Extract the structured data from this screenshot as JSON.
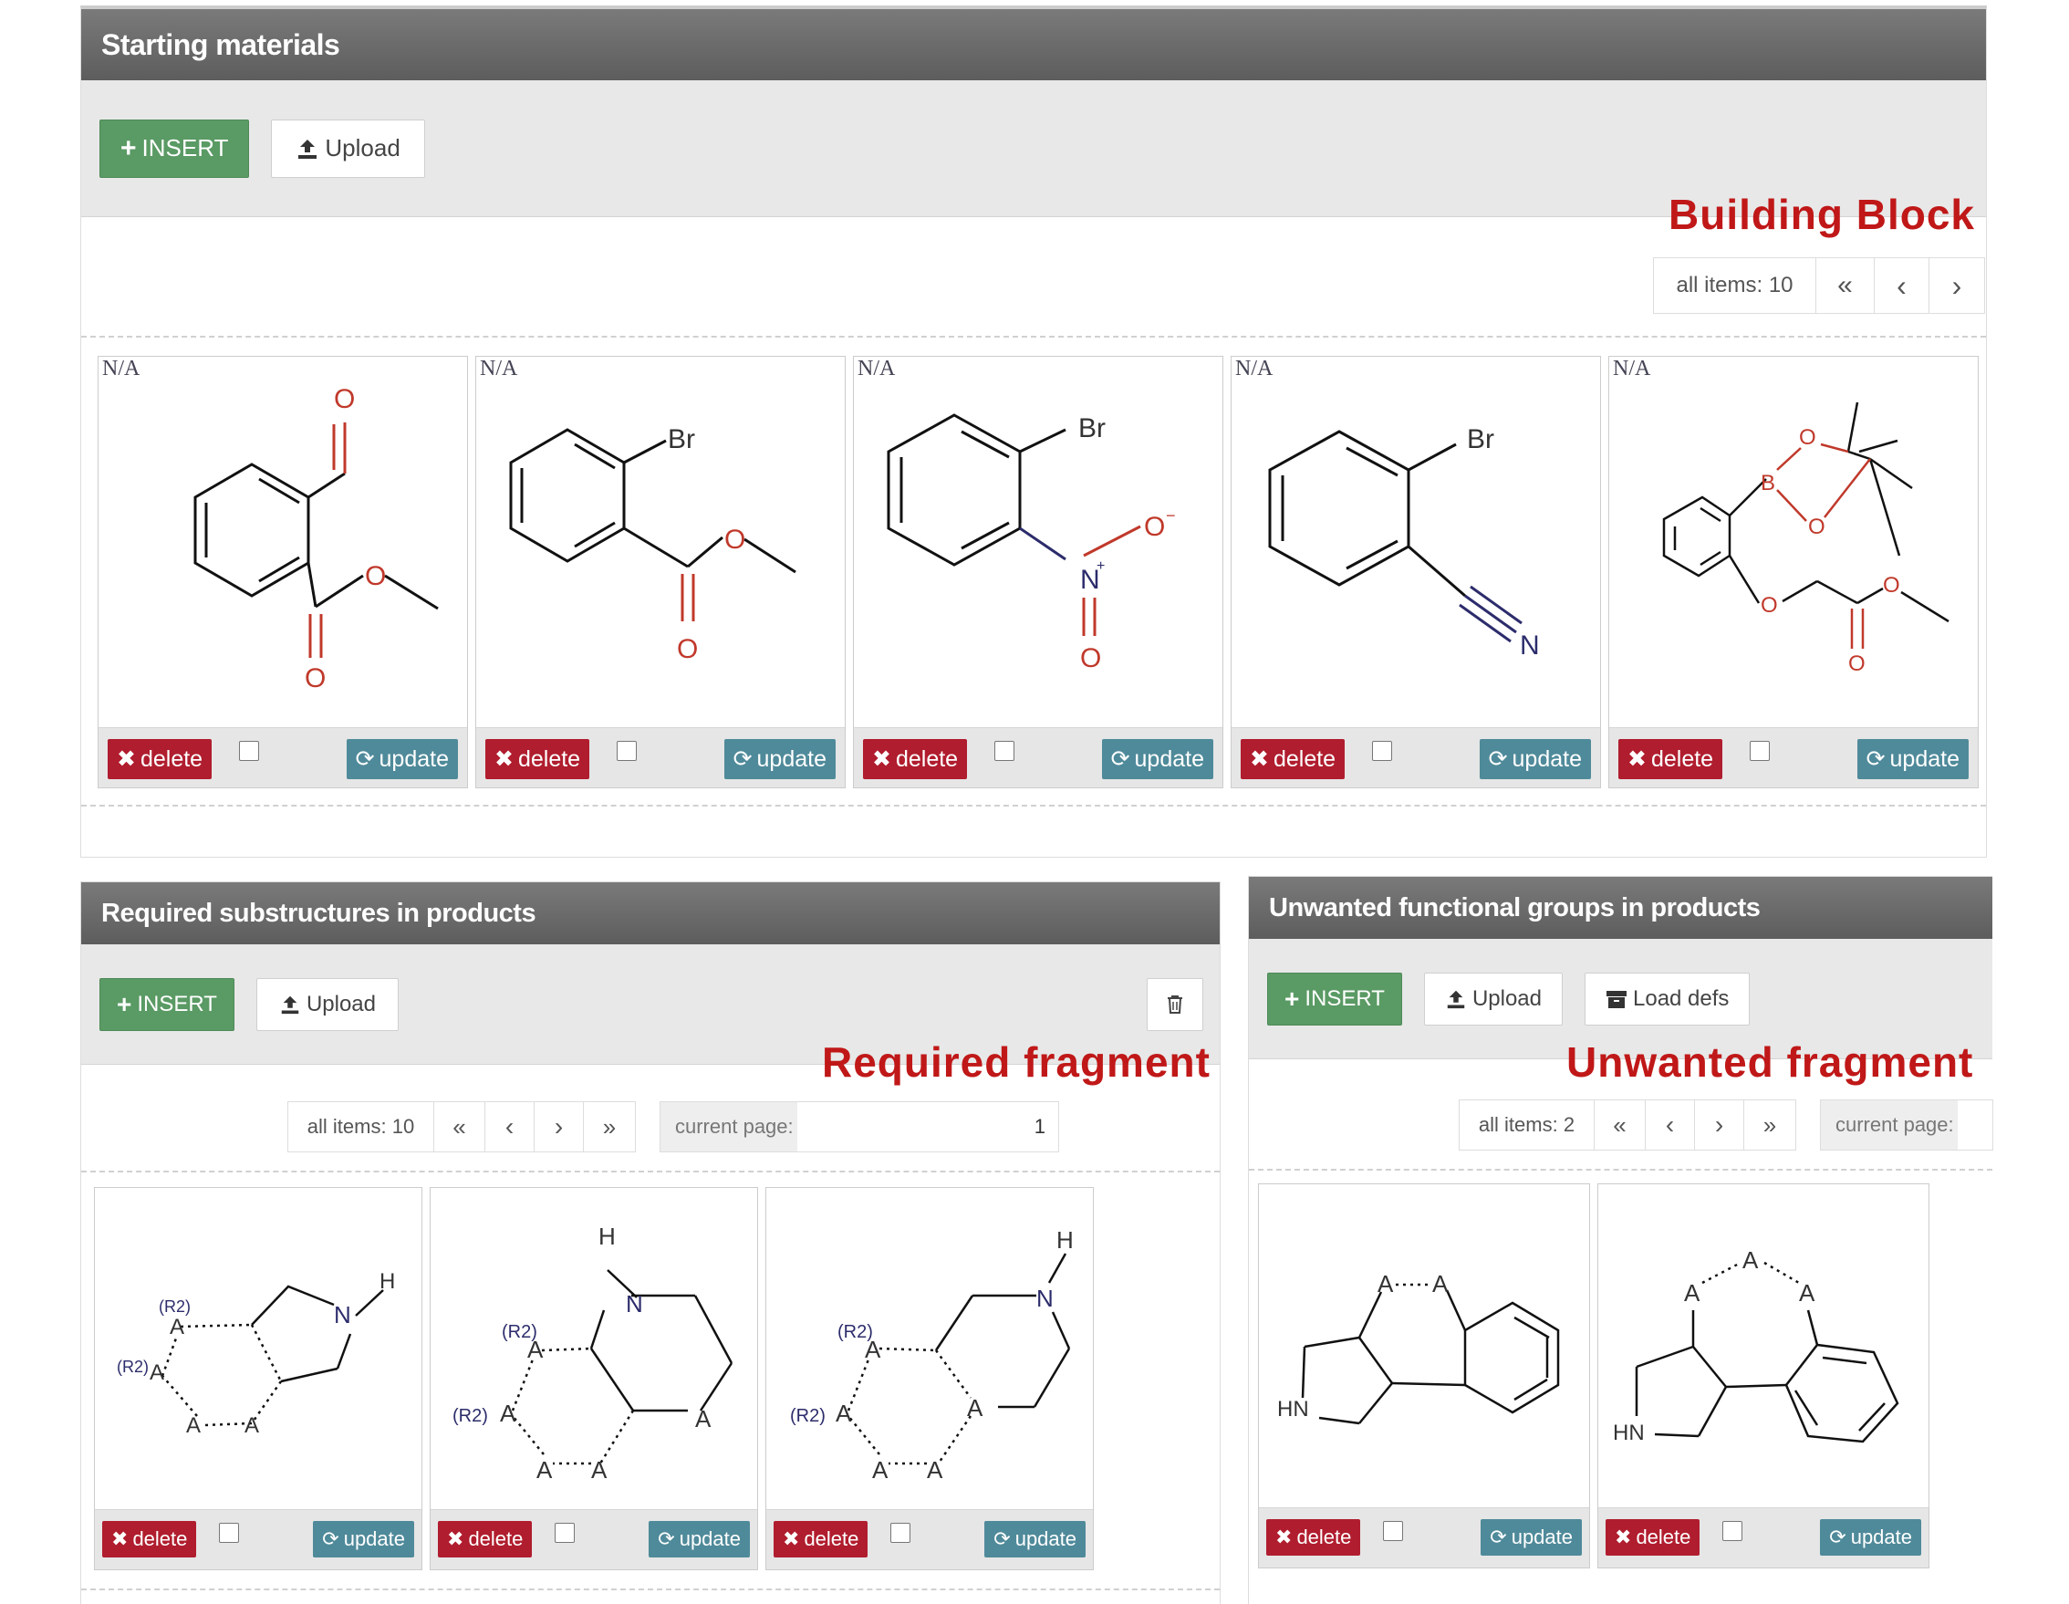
{
  "starting": {
    "title": "Starting materials",
    "insert_label": "INSERT",
    "upload_label": "Upload",
    "annotation": "Building Block",
    "pager": {
      "all_items": "all items: 10",
      "first": "«",
      "prev": "‹",
      "next": "›"
    },
    "cards": [
      {
        "tag": "N/A",
        "molecule": "methyl 2-formylbenzoate"
      },
      {
        "tag": "N/A",
        "molecule": "methyl 2-bromobenzoate"
      },
      {
        "tag": "N/A",
        "molecule": "1-bromo-2-nitrobenzene"
      },
      {
        "tag": "N/A",
        "molecule": "2-bromobenzonitrile"
      },
      {
        "tag": "N/A",
        "molecule": "aryl pinacol boronate ester with methyl oxyacetate"
      }
    ],
    "card_delete": "delete",
    "card_update": "update"
  },
  "required": {
    "title": "Required substructures in products",
    "insert_label": "INSERT",
    "upload_label": "Upload",
    "annotation": "Required fragment",
    "pager": {
      "all_items": "all items: 10",
      "first": "«",
      "prev": "‹",
      "next": "›",
      "last": "»"
    },
    "current_page_label": "current page:",
    "current_page_value": "1",
    "card_delete": "delete",
    "card_update": "update",
    "cards": [
      {
        "molecule": "fused pyrrolidine fragment"
      },
      {
        "molecule": "fused piperidine fragment"
      },
      {
        "molecule": "fused piperidine fragment 2"
      }
    ]
  },
  "unwanted": {
    "title": "Unwanted functional groups in products",
    "insert_label": "INSERT",
    "upload_label": "Upload",
    "load_defs_label": "Load defs",
    "annotation": "Unwanted fragment",
    "pager": {
      "all_items": "all items: 2",
      "first": "«",
      "prev": "‹",
      "next": "›",
      "last": "»"
    },
    "current_page_label": "current page:",
    "card_delete": "delete",
    "card_update": "update",
    "cards": [
      {
        "molecule": "pyrrolidine-benzene bridged A-A"
      },
      {
        "molecule": "pyrrolidine-benzene bridged A-A-A"
      }
    ]
  },
  "icons": {
    "plus": "plus-icon",
    "upload": "upload-icon",
    "times": "times-icon",
    "refresh": "refresh-icon",
    "trash": "trash-icon",
    "archive": "archive-icon"
  },
  "colors": {
    "insert": "#5a9a64",
    "delete": "#b01d2e",
    "update": "#4f8a9a",
    "annotation": "#c01818",
    "header": "#6a6a6a"
  }
}
